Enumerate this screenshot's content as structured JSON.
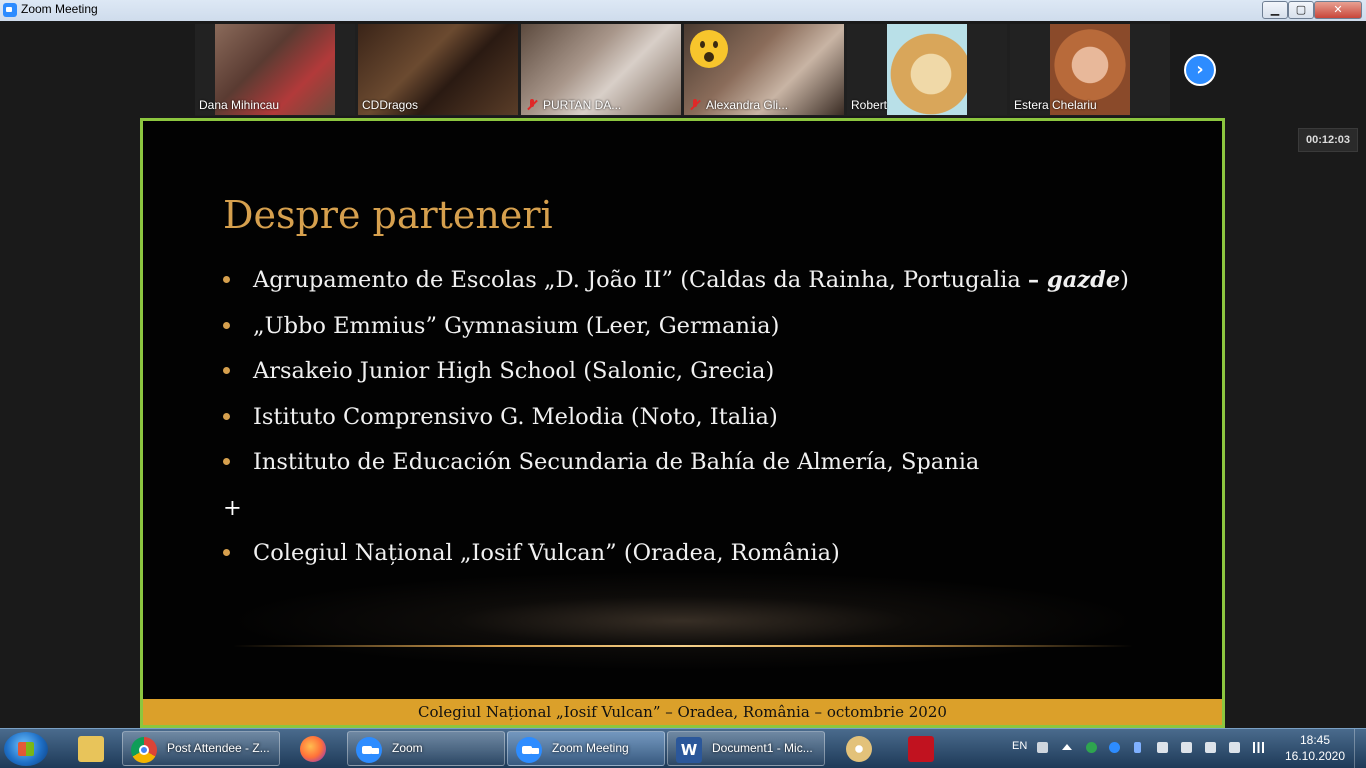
{
  "window": {
    "title": "Zoom Meeting",
    "minimize": "▁",
    "maximize": "▢",
    "close": "✕"
  },
  "participants": [
    {
      "name": "Dana Mihincau",
      "muted": false
    },
    {
      "name": "CDDragos",
      "muted": false,
      "active_speaker": true
    },
    {
      "name": "PURTAN DA...",
      "muted": true
    },
    {
      "name": "Alexandra Gli...",
      "muted": true,
      "reaction": "surprised-emoji"
    },
    {
      "name": "Robert",
      "muted": false
    },
    {
      "name": "Estera Chelariu",
      "muted": false
    }
  ],
  "next_page_glyph": "›",
  "timer": "00:12:03",
  "slide": {
    "title": "Despre parteneri",
    "bullets": [
      {
        "text": "Agrupamento de Escolas „D. João II” (Caldas da Rainha, Portugalia ",
        "dash": "– ",
        "emph": "gazde",
        "tail": ")"
      },
      {
        "text": "„Ubbo Emmius” Gymnasium (Leer, Germania)"
      },
      {
        "text": "Arsakeio Junior High School (Salonic, Grecia)"
      },
      {
        "text": "Istituto Comprensivo G. Melodia (Noto, Italia)"
      },
      {
        "text": "Instituto de Educación Secundaria de Bahía de Almería, Spania"
      }
    ],
    "plus": "+",
    "last_bullet": "Colegiul Național „Iosif Vulcan” (Oradea, România)",
    "footer": "Colegiul Național „Iosif Vulcan” – Oradea, România – octombrie 2020",
    "accent_color": "#d6a04e",
    "footer_color": "#dba02a",
    "border_color": "#8cc63f"
  },
  "taskbar": {
    "items": [
      {
        "label": "Post Attendee - Z...",
        "icon": "chrome-icon"
      },
      {
        "label": "Zoom",
        "icon": "zoom-icon"
      },
      {
        "label": "Zoom Meeting",
        "icon": "zoom-icon",
        "active": true
      },
      {
        "label": "Document1 - Mic...",
        "icon": "word-icon"
      }
    ],
    "word_glyph": "W",
    "language": "EN",
    "time": "18:45",
    "date": "16.10.2020"
  }
}
